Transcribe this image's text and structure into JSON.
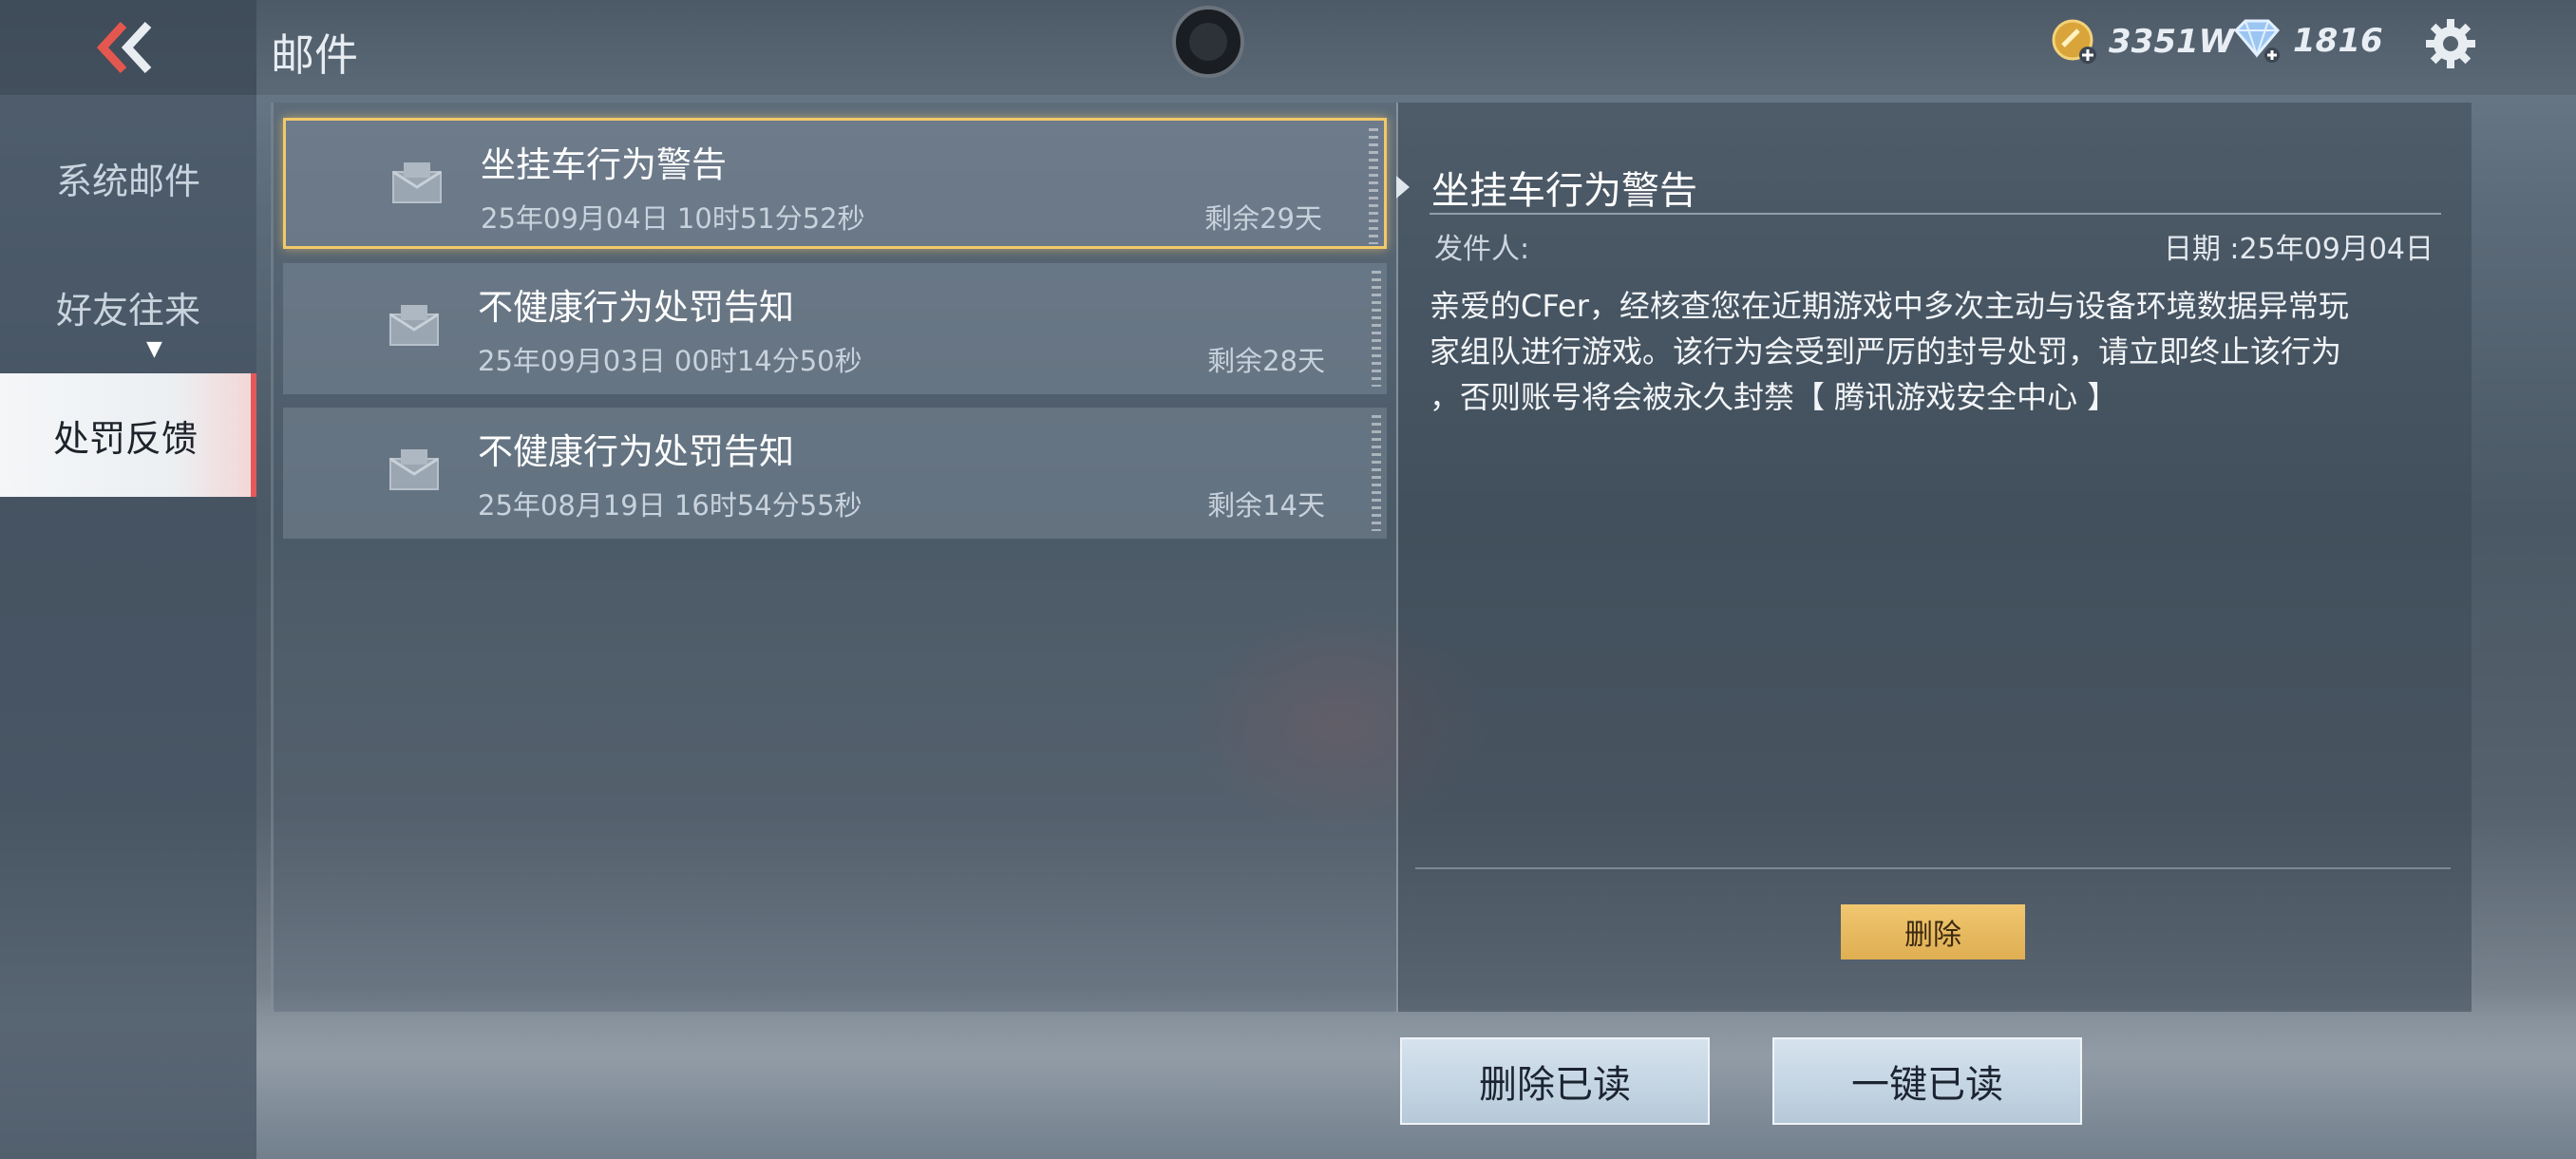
{
  "header": {
    "title": "邮件",
    "gold": "3351W",
    "diamond": "1816"
  },
  "sidebar": {
    "items": [
      {
        "label": "系统邮件"
      },
      {
        "label": "好友往来"
      },
      {
        "label": "处罚反馈"
      }
    ]
  },
  "mails": [
    {
      "title": "坐挂车行为警告",
      "time": "25年09月04日 10时51分52秒",
      "remain": "剩余29天"
    },
    {
      "title": "不健康行为处罚告知",
      "time": "25年09月03日 00时14分50秒",
      "remain": "剩余28天"
    },
    {
      "title": "不健康行为处罚告知",
      "time": "25年08月19日 16时54分55秒",
      "remain": "剩余14天"
    }
  ],
  "detail": {
    "title": "坐挂车行为警告",
    "sender_label": "发件人:",
    "date_label": "日期 :25年09月04日",
    "body_lines": [
      "亲爱的CFer，经核查您在近期游戏中多次主动与设备环境数据异常玩",
      "家组队进行游戏。该行为会受到严厉的封号处罚，请立即终止该行为",
      "，否则账号将会被永久封禁【 腾讯游戏安全中心 】"
    ],
    "delete_label": "删除"
  },
  "actions": {
    "delete_read": "删除已读",
    "mark_all_read": "一键已读"
  },
  "colors": {
    "accent_gold": "#f1c96a",
    "accent_red": "#e35a5a"
  }
}
